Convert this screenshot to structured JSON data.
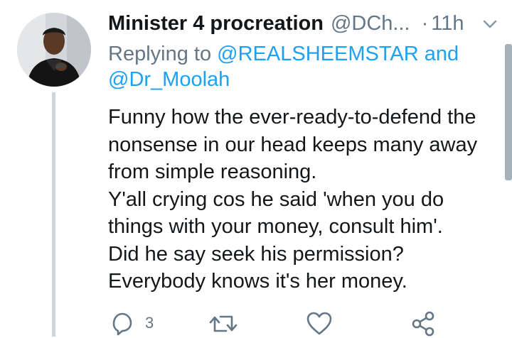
{
  "tweet": {
    "author": {
      "display_name": "Minister 4 procreation",
      "handle": "@DCh...",
      "separator": "·",
      "time": "11h",
      "avatar_icon": "user-avatar"
    },
    "reply": {
      "prefix": "Replying to",
      "mention_1": "@REALSHEEMSTAR",
      "conjunction": "and",
      "mention_2": "@Dr_Moolah"
    },
    "text_lines": [
      "Funny how the ever-ready-to-defend the",
      "nonsense in our head keeps many away",
      "from simple reasoning.",
      "Y'all crying cos he said 'when you do",
      "things with your money, consult him'.",
      "Did he say seek his permission?",
      "Everybody knows it's her money."
    ],
    "actions": {
      "reply": {
        "icon": "reply-icon",
        "count": "3"
      },
      "retweet": {
        "icon": "retweet-icon"
      },
      "like": {
        "icon": "heart-icon"
      },
      "share": {
        "icon": "share-icon"
      }
    }
  },
  "colors": {
    "text": "#14171a",
    "secondary": "#657786",
    "link": "#1da1f2",
    "thread_line": "#ccd6dd",
    "background": "#ffffff"
  }
}
